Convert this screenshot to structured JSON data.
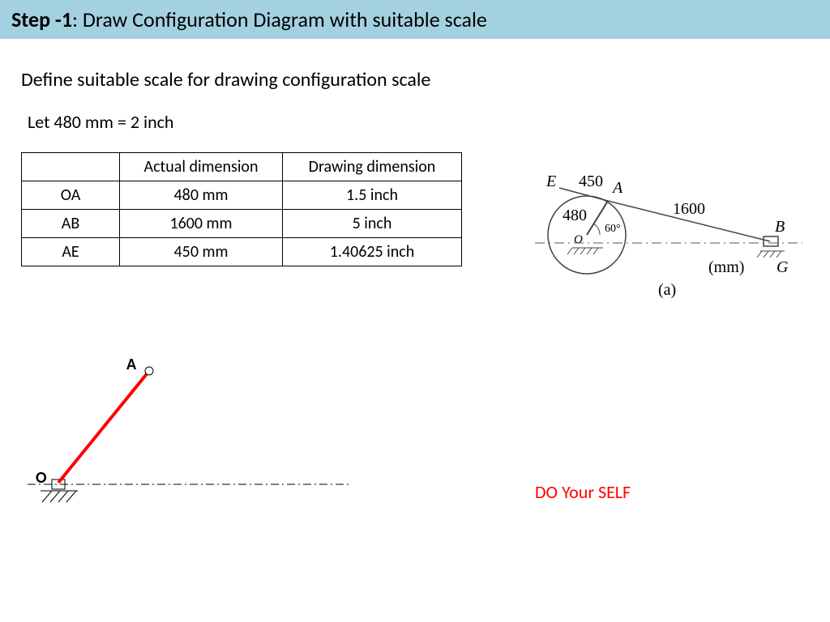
{
  "header": {
    "step_label": "Step -1",
    "title": ": Draw Configuration Diagram with suitable scale"
  },
  "subtitle": "Define suitable scale for drawing configuration scale",
  "scale_definition": "Let  480 mm = 2 inch",
  "table": {
    "headers": {
      "blank": "",
      "col1": "Actual dimension",
      "col2": "Drawing dimension"
    },
    "rows": [
      {
        "name": "OA",
        "actual": "480 mm",
        "drawing": "1.5 inch"
      },
      {
        "name": "AB",
        "actual": "1600 mm",
        "drawing": "5 inch"
      },
      {
        "name": "AE",
        "actual": "450 mm",
        "drawing": "1.40625 inch"
      }
    ]
  },
  "diagram": {
    "point_O": "O",
    "point_A": "A"
  },
  "ref": {
    "E": "E",
    "A": "A",
    "B": "B",
    "G": "G",
    "O": "O",
    "d450": "450",
    "d480": "480",
    "d1600": "1600",
    "a60": "60°",
    "units": "(mm)",
    "label": "(a)"
  },
  "note": "DO Your SELF"
}
